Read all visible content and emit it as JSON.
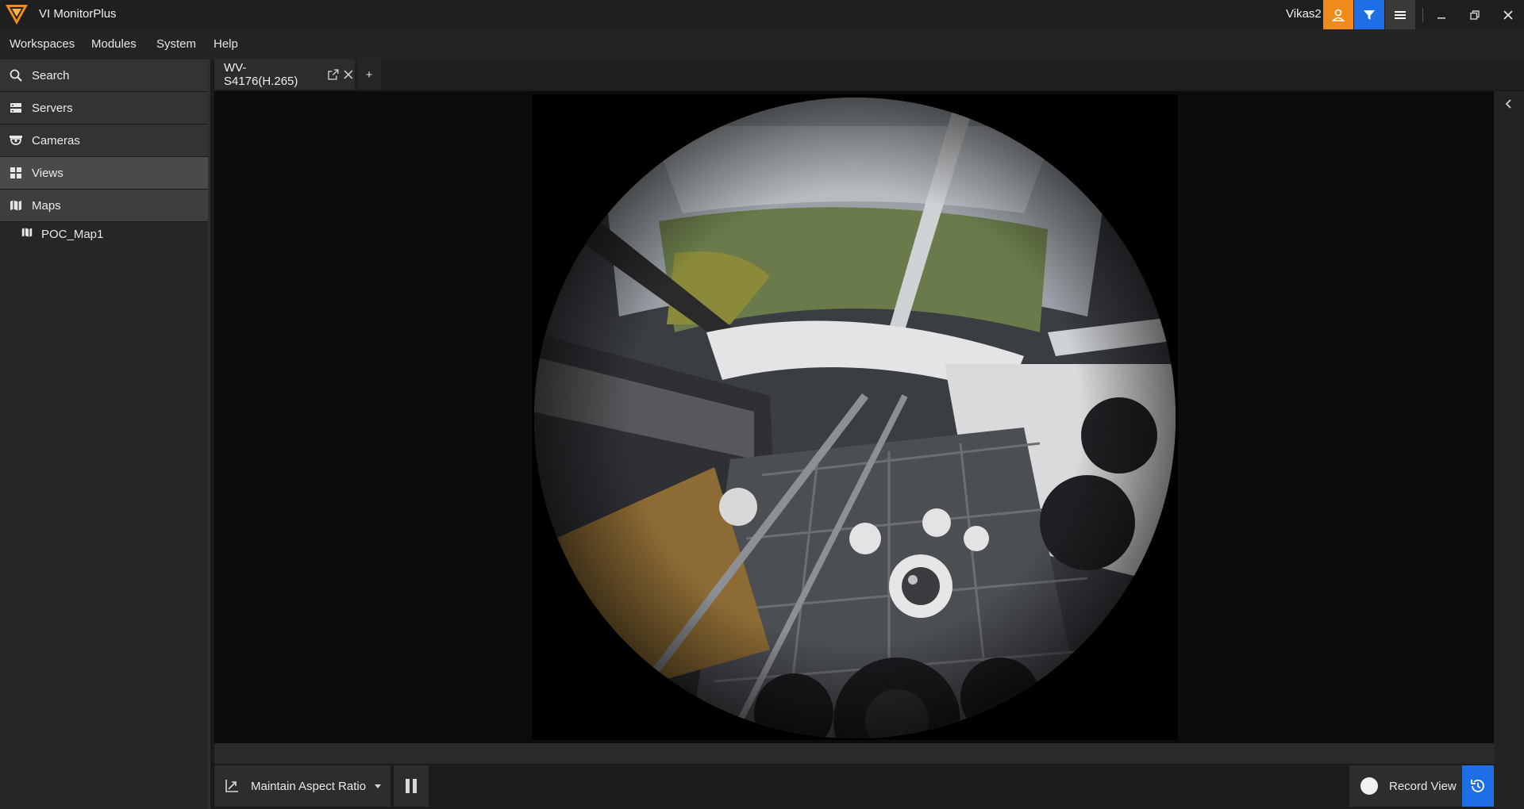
{
  "app": {
    "title": "VI MonitorPlus",
    "username": "Vikas2"
  },
  "colors": {
    "accent_orange": "#f08a1c",
    "accent_blue": "#1e6fe6",
    "logo_orange": "#f28c1b"
  },
  "titlebar": {
    "icons": [
      "user-icon",
      "filter-icon",
      "hamburger-menu-icon",
      "minimize-icon",
      "restore-icon",
      "close-icon"
    ]
  },
  "menu": {
    "items": [
      {
        "label": "Workspaces"
      },
      {
        "label": "Modules"
      },
      {
        "label": "System"
      },
      {
        "label": "Help"
      }
    ]
  },
  "sidebar": {
    "items": [
      {
        "label": "Search",
        "icon": "search-icon"
      },
      {
        "label": "Servers",
        "icon": "server-icon"
      },
      {
        "label": "Cameras",
        "icon": "camera-icon"
      },
      {
        "label": "Views",
        "icon": "grid-icon"
      },
      {
        "label": "Maps",
        "icon": "map-icon"
      }
    ],
    "maps": [
      {
        "label": "POC_Map1",
        "icon": "map-icon"
      }
    ]
  },
  "tabs": {
    "items": [
      {
        "label": "WV-S4176(H.265)",
        "active": true
      }
    ],
    "add_label": "+"
  },
  "toolbar": {
    "aspect_label": "Maintain Aspect Ratio",
    "record_label": "Record View",
    "icons": [
      "aspect-ratio-icon",
      "dropdown-caret-icon",
      "pause-icon",
      "record-dot-icon",
      "history-icon"
    ]
  }
}
